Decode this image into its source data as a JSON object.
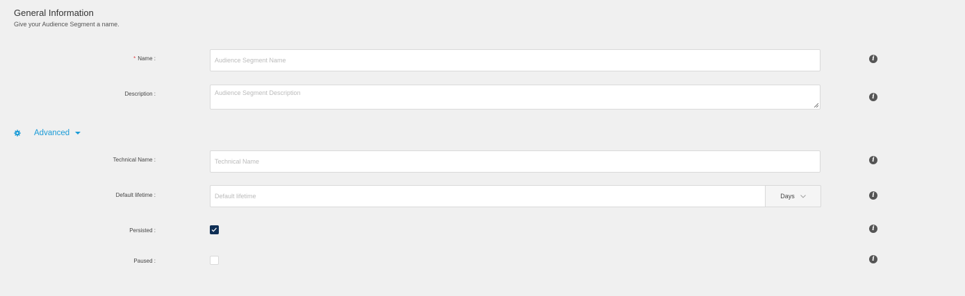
{
  "section": {
    "title": "General Information",
    "subtitle": "Give your Audience Segment a name."
  },
  "fields": {
    "name": {
      "required_mark": "*",
      "label": "Name :",
      "placeholder": "Audience Segment Name",
      "info_icon": "info-icon"
    },
    "description": {
      "label": "Description :",
      "placeholder": "Audience Segment Description",
      "info_icon": "info-icon"
    }
  },
  "advanced": {
    "label": "Advanced",
    "icon": "gear-icon",
    "toggle_icon": "caret-down-icon",
    "accent_color": "#1a9bd7"
  },
  "advanced_fields": {
    "technical_name": {
      "label": "Technical Name :",
      "placeholder": "Technical Name"
    },
    "default_lifetime": {
      "label": "Default lifetime :",
      "placeholder": "Default lifetime",
      "unit": "Days"
    },
    "persisted": {
      "label": "Persisted :",
      "checked": true
    },
    "paused": {
      "label": "Paused :",
      "checked": false
    }
  },
  "colors": {
    "background": "#f0f0f0",
    "checkbox_checked": "#0f2f55",
    "required": "#e0393e"
  }
}
